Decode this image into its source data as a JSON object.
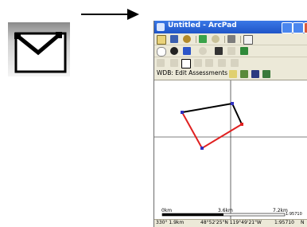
{
  "window": {
    "title": "Untitled - ArcPad"
  },
  "wdb_toolbar": {
    "label": "WDB: Edit Assessments"
  },
  "map": {
    "scalebar": {
      "left_label": "0km",
      "mid_label": "3.6km",
      "right_label": "7.2km",
      "ratio_label": "1:95710"
    }
  },
  "statusbar": {
    "bearing": "330° 1.9km",
    "coordinates": "48°52'25\"N 119°49'21\"W",
    "scale": "1:95710",
    "mode": "N"
  },
  "icons": [
    "polygon-tool-icon-zoomed",
    "arrow-icon",
    "new-icon",
    "save-icon",
    "gps-icon",
    "layers-icon",
    "zoom-in-icon",
    "pan-icon",
    "back-icon",
    "identify-icon",
    "find-icon",
    "select-icon",
    "polygon-tool-icon"
  ],
  "colors": {
    "polygon_edge_black": "#000000",
    "polygon_edge_red": "#e02020",
    "vertex": "#3030c0",
    "titlebar": "#2a62d8"
  }
}
